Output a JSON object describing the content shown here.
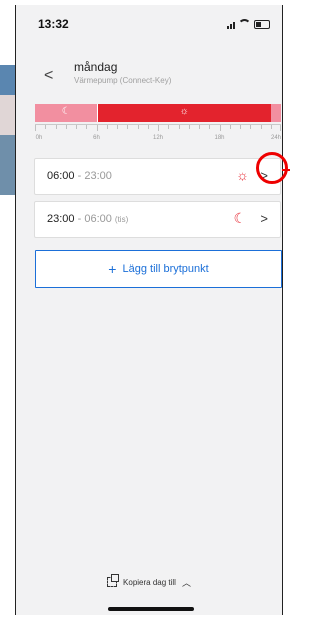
{
  "status_bar": {
    "time": "13:32"
  },
  "header": {
    "back_label": "<",
    "title": "måndag",
    "subtitle": "Värmepump (Connect-Key)"
  },
  "timeline": {
    "segments": [
      {
        "from_hour": 0,
        "to_hour": 6,
        "mode": "night",
        "color": "#f28fa0"
      },
      {
        "from_hour": 6,
        "to_hour": 23,
        "mode": "day",
        "color": "#e3232d"
      },
      {
        "from_hour": 23,
        "to_hour": 24,
        "mode": "night",
        "color": "#f28fa0"
      }
    ],
    "axis_labels": [
      "0h",
      "6h",
      "12h",
      "18h",
      "24h"
    ]
  },
  "schedule": [
    {
      "start": "06:00",
      "end": "23:00",
      "end_day": "",
      "mode_icon": "sun-icon"
    },
    {
      "start": "23:00",
      "end": "06:00",
      "end_day": "(tis)",
      "mode_icon": "moon-icon"
    }
  ],
  "add_button": {
    "label": "Lägg till brytpunkt"
  },
  "footer": {
    "copy_label": "Kopiera dag till"
  },
  "colors": {
    "accent": "#1b6fd8",
    "day": "#e3232d",
    "night": "#f28fa0",
    "highlight": "#ee0000"
  }
}
